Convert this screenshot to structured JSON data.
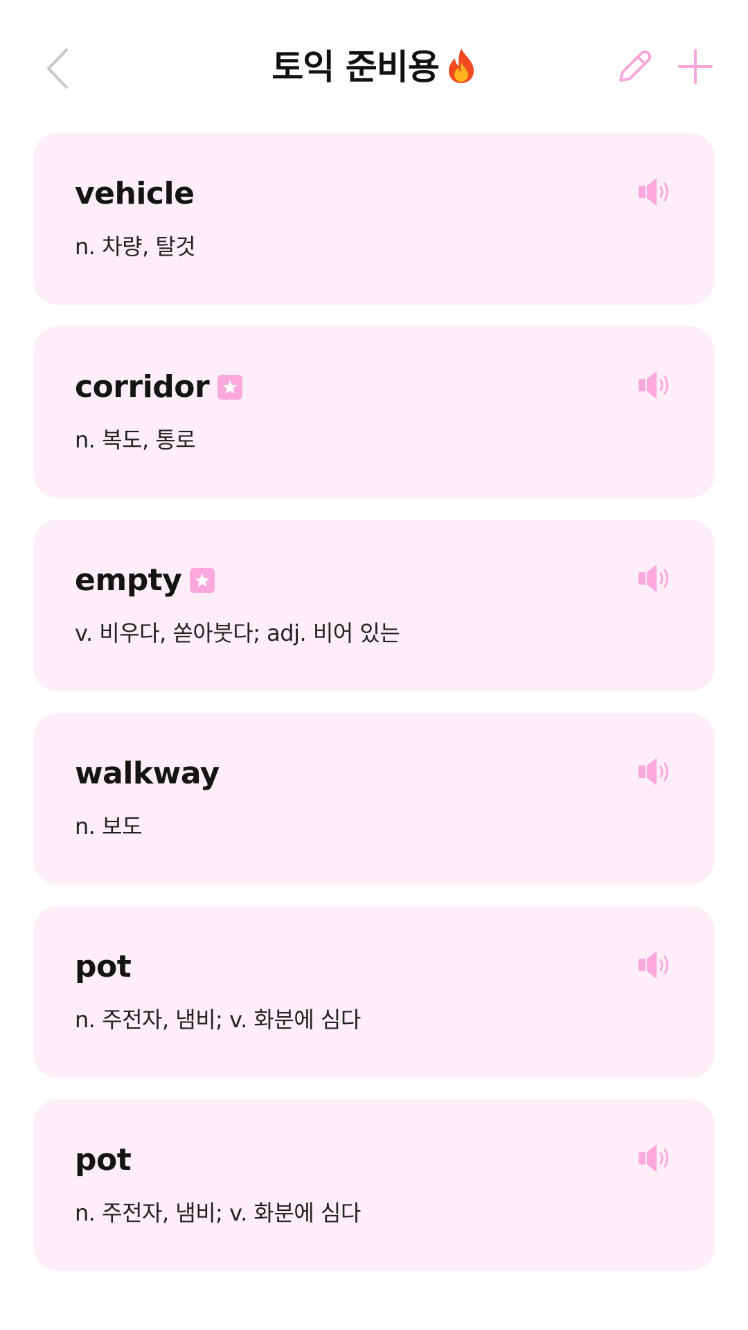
{
  "header": {
    "title": "토익 준비용",
    "icons": {
      "back": "chevron-left-icon",
      "flame": "fire-icon",
      "edit": "pencil-icon",
      "add": "plus-icon"
    }
  },
  "colors": {
    "accent": "#fba8de",
    "card_background": "#fdeef8",
    "text": "#141414",
    "back_icon": "#c8c8c8"
  },
  "words": [
    {
      "word": "vehicle",
      "meaning": "n. 차량, 탈것",
      "starred": false
    },
    {
      "word": "corridor",
      "meaning": "n. 복도, 통로",
      "starred": true
    },
    {
      "word": "empty",
      "meaning": "v. 비우다, 쏟아붓다; adj. 비어 있는",
      "starred": true
    },
    {
      "word": "walkway",
      "meaning": "n. 보도",
      "starred": false
    },
    {
      "word": "pot",
      "meaning": "n. 주전자, 냄비; v. 화분에 심다",
      "starred": false
    },
    {
      "word": "pot",
      "meaning": "n. 주전자, 냄비; v. 화분에 심다",
      "starred": false
    }
  ]
}
